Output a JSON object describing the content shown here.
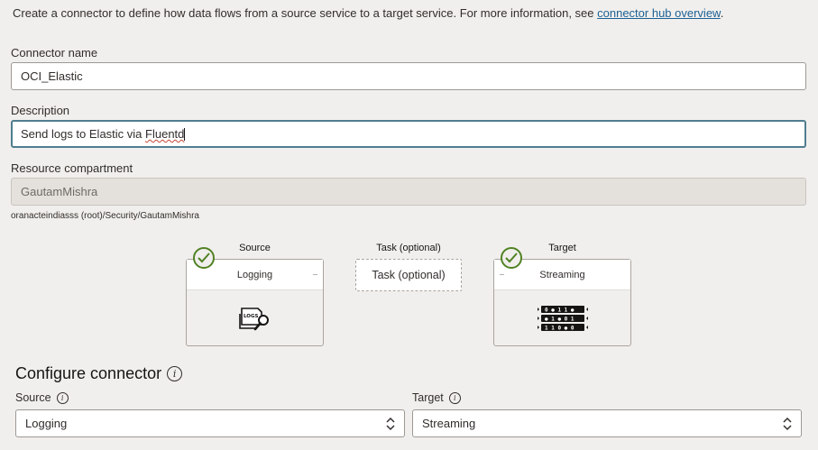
{
  "intro": {
    "text": "Create a connector to define how data flows from a source service to a target service. For more information, see ",
    "link": "connector hub overview",
    "suffix": "."
  },
  "connector_name": {
    "label": "Connector name",
    "value": "OCI_Elastic"
  },
  "description": {
    "label": "Description",
    "value_prefix": "Send logs to Elastic via ",
    "value_misspelled": "Fluentd"
  },
  "compartment": {
    "label": "Resource compartment",
    "value": "GautamMishra",
    "path": "oranacteindiasss (root)/Security/GautamMishra"
  },
  "flow": {
    "source": {
      "title": "Source",
      "service": "Logging",
      "icon": "logs-search-icon"
    },
    "task": {
      "title": "Task (optional)",
      "placeholder": "Task (optional)"
    },
    "target": {
      "title": "Target",
      "service": "Streaming",
      "icon": "stream-icon"
    }
  },
  "configure": {
    "title": "Configure connector",
    "source_label": "Source",
    "source_value": "Logging",
    "target_label": "Target",
    "target_value": "Streaming"
  },
  "colors": {
    "link": "#1d6195",
    "check": "#508223",
    "focus": "#4f7d8f"
  }
}
